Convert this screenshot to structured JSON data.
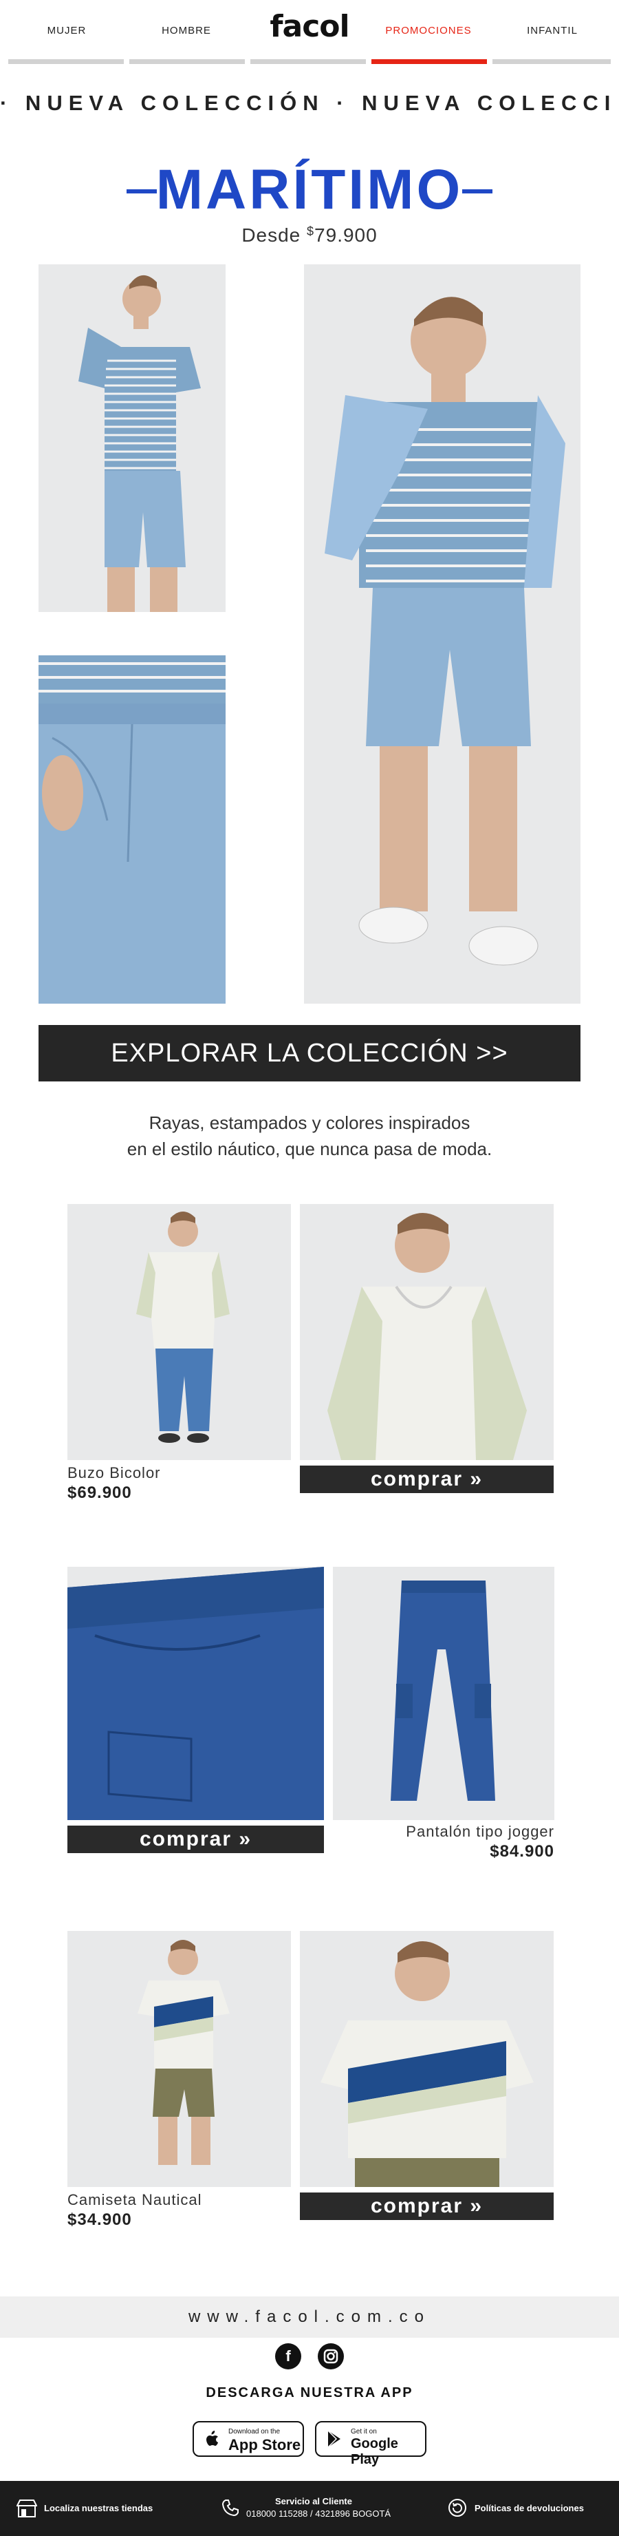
{
  "nav": {
    "items": [
      "MUJER",
      "HOMBRE",
      "PROMOCIONES",
      "INFANTIL"
    ],
    "logo": "facol",
    "active": "PROMOCIONES",
    "accent": "#e62415"
  },
  "marquee": "· NUEVA COLECCIÓN · NUEVA COLECCI",
  "hero": {
    "title": "MARÍTIMO",
    "price_prefix": "Desde",
    "price_currency": "$",
    "price": "79.900",
    "accent": "#1f48c6"
  },
  "cta": {
    "label": "EXPLORAR LA COLECCIÓN >>"
  },
  "description": {
    "line1": "Rayas, estampados y colores inspirados",
    "line2": "en el estilo náutico, que nunca pasa de moda."
  },
  "products": [
    {
      "name": "Buzo Bicolor",
      "price": "$69.900",
      "buy_label": "comprar »"
    },
    {
      "name": "Pantalón tipo jogger",
      "price": "$84.900",
      "buy_label": "comprar »"
    },
    {
      "name": "Camiseta Nautical",
      "price": "$34.900",
      "buy_label": "comprar »"
    }
  ],
  "footer": {
    "url": "www.facol.com.co",
    "social": [
      "facebook-icon",
      "instagram-icon"
    ],
    "download_title": "DESCARGA NUESTRA APP",
    "app_store_small": "Download on the",
    "app_store_big": "App Store",
    "google_small": "Get it on",
    "google_big": "Google Play",
    "stores_label": "Localiza nuestras tiendas",
    "service_title": "Servicio al Cliente",
    "service_phone": "018000 115288 / 4321896 BOGOTÁ",
    "returns_label": "Políticas de devoluciones"
  }
}
